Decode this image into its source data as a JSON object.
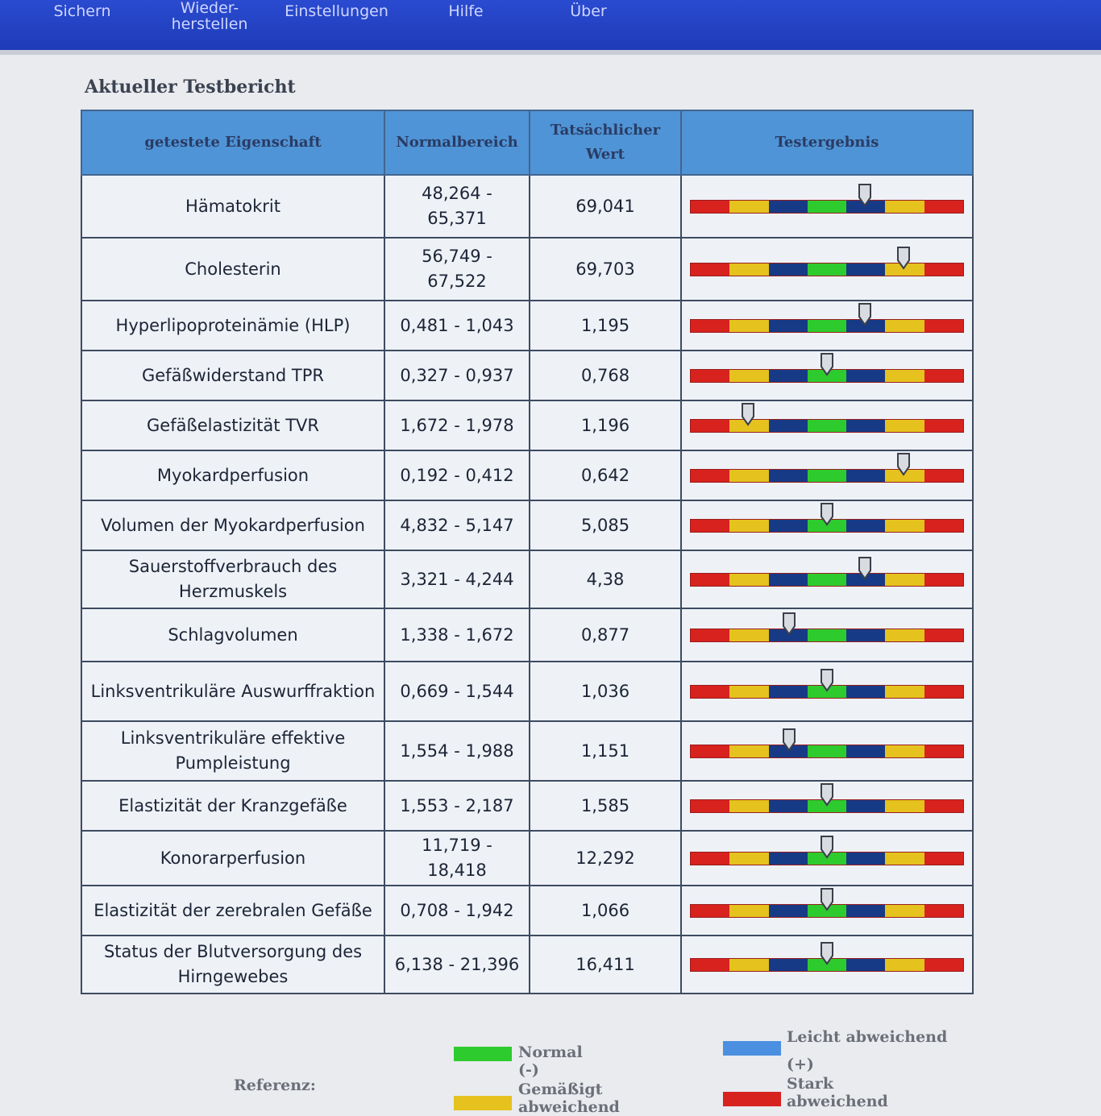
{
  "menu": [
    {
      "label": "Sichern"
    },
    {
      "label": "Wieder-\nherstellen"
    },
    {
      "label": "Einstellungen"
    },
    {
      "label": "Hilfe"
    },
    {
      "label": "Über"
    }
  ],
  "page_title": "Aktueller Testbericht",
  "table": {
    "headers": [
      "getestete Eigenschaft",
      "Normalbereich",
      "Tatsächlicher Wert",
      "Testergebnis"
    ],
    "scale_colors": [
      "#d7221e",
      "#e5c21e",
      "#173a86",
      "#2ecb2e",
      "#173a86",
      "#e5c21e",
      "#d7221e"
    ],
    "rows": [
      {
        "name": "Hämatokrit",
        "range": "48,264 - 65,371",
        "value": "69,041",
        "pointer": 0.64
      },
      {
        "name": "Cholesterin",
        "range": "56,749 - 67,522",
        "value": "69,703",
        "pointer": 0.78
      },
      {
        "name": "Hyperlipoproteinämie (HLP)",
        "range": "0,481 - 1,043",
        "value": "1,195",
        "pointer": 0.64
      },
      {
        "name": "Gefäßwiderstand TPR",
        "range": "0,327 - 0,937",
        "value": "0,768",
        "pointer": 0.5
      },
      {
        "name": "Gefäßelastizität TVR",
        "range": "1,672 - 1,978",
        "value": "1,196",
        "pointer": 0.21
      },
      {
        "name": "Myokardperfusion",
        "range": "0,192 - 0,412",
        "value": "0,642",
        "pointer": 0.78
      },
      {
        "name": "Volumen der Myokardperfusion",
        "range": "4,832 - 5,147",
        "value": "5,085",
        "pointer": 0.5
      },
      {
        "name": "Sauerstoffverbrauch des Herzmuskels",
        "range": "3,321 - 4,244",
        "value": "4,38",
        "pointer": 0.64
      },
      {
        "name": "Schlagvolumen",
        "range": "1,338 - 1,672",
        "value": "0,877",
        "pointer": 0.36
      },
      {
        "name": "Linksventrikuläre Auswurffraktion",
        "range": "0,669 - 1,544",
        "value": "1,036",
        "pointer": 0.5
      },
      {
        "name": "Linksventrikuläre effektive Pumpleistung",
        "range": "1,554 - 1,988",
        "value": "1,151",
        "pointer": 0.36
      },
      {
        "name": "Elastizität der Kranzgefäße",
        "range": "1,553 - 2,187",
        "value": "1,585",
        "pointer": 0.5
      },
      {
        "name": "Konorarperfusion",
        "range": "11,719 - 18,418",
        "value": "12,292",
        "pointer": 0.5
      },
      {
        "name": "Elastizität der zerebralen Gefäße",
        "range": "0,708 - 1,942",
        "value": "1,066",
        "pointer": 0.5
      },
      {
        "name": "Status der Blutversorgung des Hirngewebes",
        "range": "6,138 - 21,396",
        "value": "16,411",
        "pointer": 0.5
      }
    ]
  },
  "legend": {
    "reference_label": "Referenz:",
    "items": [
      {
        "label": "Normal (-)",
        "color": "#2ecb2e"
      },
      {
        "label": "Leicht abweichend (+)",
        "color": "#4b8fe0"
      },
      {
        "label": "Gemäßigt abweichend",
        "color": "#e5c21e"
      },
      {
        "label": "Stark abweichend",
        "color": "#d7221e"
      }
    ]
  }
}
